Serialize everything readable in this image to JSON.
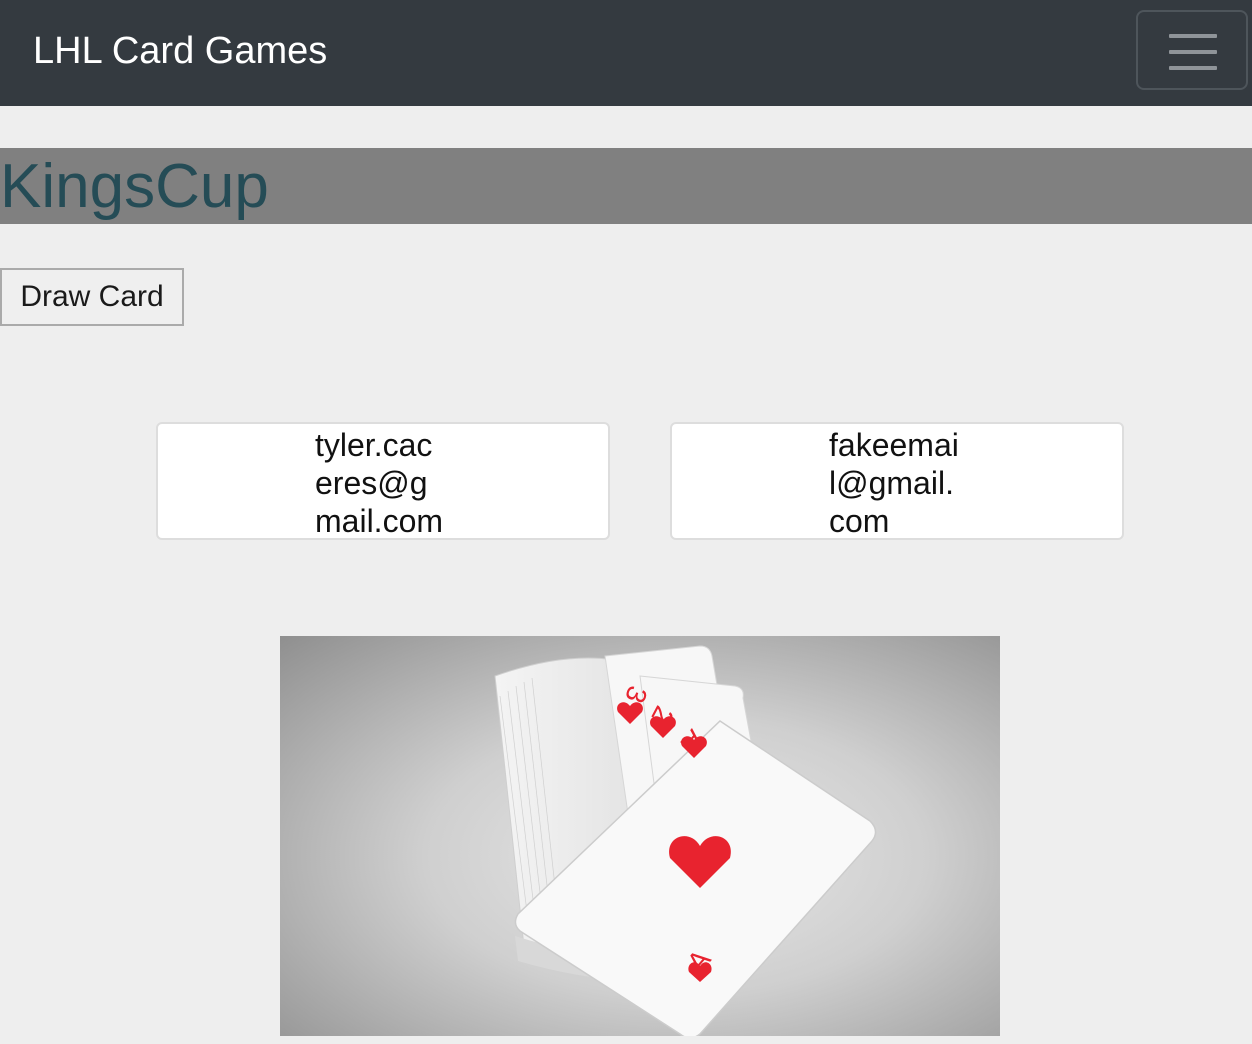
{
  "navbar": {
    "brand": "LHL Card Games",
    "menu_toggle_icon": "hamburger-menu-icon"
  },
  "game": {
    "title": "KingsCup",
    "draw_button_label": "Draw Card"
  },
  "players": [
    {
      "email": "tyler.caceres@gmail.com"
    },
    {
      "email": "fakeemail@gmail.com"
    }
  ],
  "card_image": {
    "icon": "playing-cards-image",
    "corner_ranks": [
      "3",
      "2",
      "A"
    ],
    "bottom_rank": "A",
    "suit_color": "#e8232f"
  },
  "colors": {
    "navbar_bg": "#343a40",
    "title_band": "#808080",
    "title_text": "#254c56",
    "page_bg": "#eeeeee"
  }
}
